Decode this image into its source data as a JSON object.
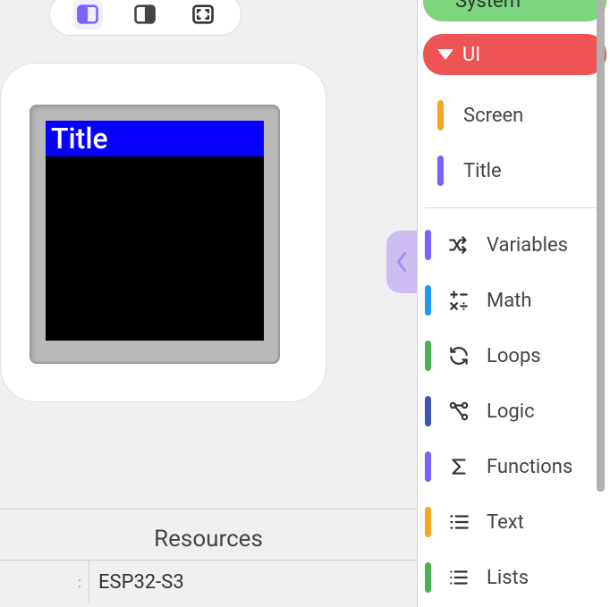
{
  "toolbar": {
    "active_view": "split"
  },
  "device": {
    "title": "Title"
  },
  "resources": {
    "header": "Resources",
    "chip": "ESP32-S3"
  },
  "categories": {
    "system": {
      "label": "System",
      "color": "#7bd67e"
    },
    "ui": {
      "label": "UI",
      "color": "#ef5454",
      "items": [
        {
          "label": "Screen",
          "bar_color": "#f5a623"
        },
        {
          "label": "Title",
          "bar_color": "#7b61ff"
        }
      ]
    },
    "list": [
      {
        "key": "variables",
        "label": "Variables",
        "icon": "shuffle",
        "bar_color": "#7b61ff"
      },
      {
        "key": "math",
        "label": "Math",
        "icon": "ops",
        "bar_color": "#2196f3"
      },
      {
        "key": "loops",
        "label": "Loops",
        "icon": "cycle",
        "bar_color": "#4caf50"
      },
      {
        "key": "logic",
        "label": "Logic",
        "icon": "graph",
        "bar_color": "#3f51b5"
      },
      {
        "key": "functions",
        "label": "Functions",
        "icon": "sigma",
        "bar_color": "#7b61ff"
      },
      {
        "key": "text",
        "label": "Text",
        "icon": "list-text",
        "bar_color": "#f5a623"
      },
      {
        "key": "lists",
        "label": "Lists",
        "icon": "list",
        "bar_color": "#4caf50"
      }
    ]
  }
}
